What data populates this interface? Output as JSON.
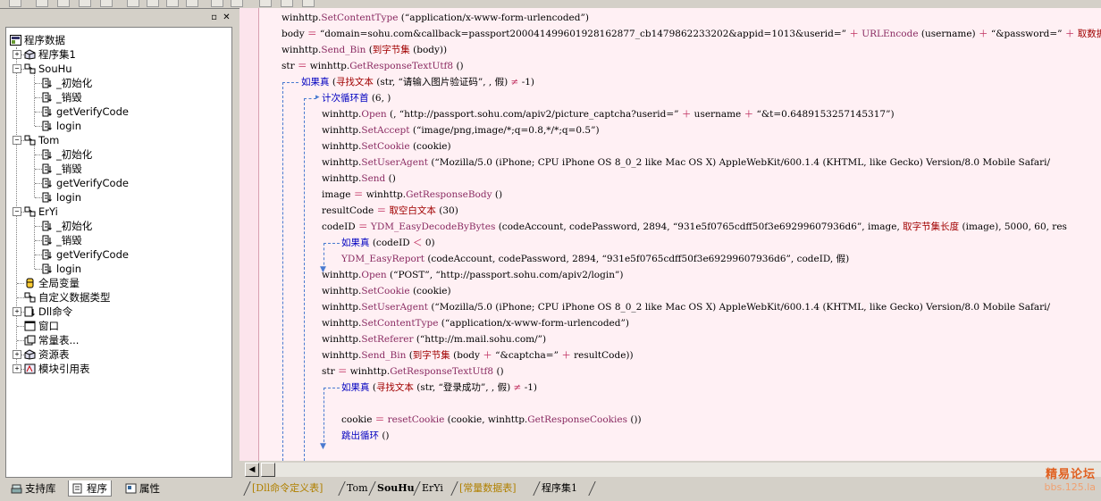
{
  "left_panel": {
    "tree": [
      {
        "label": "程序数据",
        "icon": "project-icon",
        "indent": 0,
        "toggle": ""
      },
      {
        "label": "程序集1",
        "icon": "assembly-icon",
        "indent": 1,
        "toggle": "+"
      },
      {
        "label": "SouHu",
        "icon": "class-icon",
        "indent": 1,
        "toggle": "-"
      },
      {
        "label": "_初始化",
        "icon": "method-icon",
        "indent": 2,
        "toggle": ""
      },
      {
        "label": "_销毁",
        "icon": "method-icon",
        "indent": 2,
        "toggle": ""
      },
      {
        "label": "getVerifyCode",
        "icon": "method-icon",
        "indent": 2,
        "toggle": ""
      },
      {
        "label": "login",
        "icon": "method-icon",
        "indent": 2,
        "toggle": ""
      },
      {
        "label": "Tom",
        "icon": "class-icon",
        "indent": 1,
        "toggle": "-"
      },
      {
        "label": "_初始化",
        "icon": "method-icon",
        "indent": 2,
        "toggle": ""
      },
      {
        "label": "_销毁",
        "icon": "method-icon",
        "indent": 2,
        "toggle": ""
      },
      {
        "label": "getVerifyCode",
        "icon": "method-icon",
        "indent": 2,
        "toggle": ""
      },
      {
        "label": "login",
        "icon": "method-icon",
        "indent": 2,
        "toggle": ""
      },
      {
        "label": "ErYi",
        "icon": "class-icon",
        "indent": 1,
        "toggle": "-"
      },
      {
        "label": "_初始化",
        "icon": "method-icon",
        "indent": 2,
        "toggle": ""
      },
      {
        "label": "_销毁",
        "icon": "method-icon",
        "indent": 2,
        "toggle": ""
      },
      {
        "label": "getVerifyCode",
        "icon": "method-icon",
        "indent": 2,
        "toggle": ""
      },
      {
        "label": "login",
        "icon": "method-icon",
        "indent": 2,
        "toggle": ""
      },
      {
        "label": "全局变量",
        "icon": "global-var-icon",
        "indent": 1,
        "toggle": ""
      },
      {
        "label": "自定义数据类型",
        "icon": "datatype-icon",
        "indent": 1,
        "toggle": ""
      },
      {
        "label": "Dll命令",
        "icon": "dll-icon",
        "indent": 1,
        "toggle": "+"
      },
      {
        "label": "窗口",
        "icon": "window-icon",
        "indent": 1,
        "toggle": ""
      },
      {
        "label": "常量表...",
        "icon": "constant-icon",
        "indent": 1,
        "toggle": ""
      },
      {
        "label": "资源表",
        "icon": "resource-icon",
        "indent": 1,
        "toggle": "+"
      },
      {
        "label": "模块引用表",
        "icon": "module-icon",
        "indent": 1,
        "toggle": "+"
      }
    ],
    "tabs": [
      {
        "label": "支持库",
        "icon": "library-icon"
      },
      {
        "label": "程序",
        "icon": "program-icon"
      },
      {
        "label": "属性",
        "icon": "properties-icon"
      }
    ],
    "header_icons": [
      "pin-icon",
      "close-icon"
    ]
  },
  "code_lines": [
    "winhttp.SetContentType (“application/x-www-form-urlencoded”)",
    "body ＝ “domain=sohu.com&callback=passport200041499601928162877_cb1479862233202&appid=1013&userid=” ＋ URLEncode (username) ＋ “&password=” ＋ 取数据",
    "winhttp.Send_Bin (到字节集 (body))",
    "str ＝ winhttp.GetResponseTextUtf8 ()",
    "如果真 (寻找文本 (str, “请输入图片验证码”, , 假) ≠ -1)",
    "计次循环首 (6, )",
    "winhttp.Open (, “http://passport.sohu.com/apiv2/picture_captcha?userid=” ＋ username ＋ “&t=0.6489153257145317”)",
    "winhttp.SetAccept (“image/png,image/*;q=0.8,*/*;q=0.5”)",
    "winhttp.SetCookie (cookie)",
    "winhttp.SetUserAgent (“Mozilla/5.0 (iPhone; CPU iPhone OS 8_0_2 like Mac OS X) AppleWebKit/600.1.4 (KHTML, like Gecko) Version/8.0 Mobile Safari/",
    "winhttp.Send ()",
    "image ＝ winhttp.GetResponseBody ()",
    "resultCode ＝ 取空白文本 (30)",
    "codeID ＝ YDM_EasyDecodeByBytes (codeAccount, codePassword, 2894, “931e5f0765cdff50f3e69299607936d6”, image, 取字节集长度 (image), 5000, 60, res",
    "如果真 (codeID ＜ 0)",
    "YDM_EasyReport (codeAccount, codePassword, 2894, “931e5f0765cdff50f3e69299607936d6”, codeID, 假)",
    "winhttp.Open (“POST”, “http://passport.sohu.com/apiv2/login”)",
    "winhttp.SetCookie (cookie)",
    "winhttp.SetUserAgent (“Mozilla/5.0 (iPhone; CPU iPhone OS 8_0_2 like Mac OS X) AppleWebKit/600.1.4 (KHTML, like Gecko) Version/8.0 Mobile Safari/",
    "winhttp.SetContentType (“application/x-www-form-urlencoded”)",
    "winhttp.SetReferer (“http://m.mail.sohu.com/”)",
    "winhttp.Send_Bin (到字节集 (body ＋ “&captcha=” ＋ resultCode))",
    "str ＝ winhttp.GetResponseTextUtf8 ()",
    "如果真 (寻找文本 (str, “登录成功”, , 假) ≠ -1)",
    "",
    "cookie ＝ resetCookie (cookie, winhttp.GetResponseCookies ())",
    "跳出循环 ()"
  ],
  "bottom_tabs": [
    {
      "label": "[Dll命令定义表]",
      "kind": "dll"
    },
    {
      "label": "Tom",
      "kind": "normal"
    },
    {
      "label": "SouHu",
      "kind": "active"
    },
    {
      "label": "ErYi",
      "kind": "normal"
    },
    {
      "label": "[常量数据表]",
      "kind": "dll"
    },
    {
      "label": "程序集1",
      "kind": "normal"
    }
  ],
  "watermark": {
    "line1": "精易论坛",
    "line2": "bbs.125.la"
  },
  "colors": {
    "method": "#8a2b62",
    "keyword": "#0000c0",
    "constant": "#a00000",
    "guide": "#4a7ad0",
    "gutter": "#fce4ec"
  }
}
